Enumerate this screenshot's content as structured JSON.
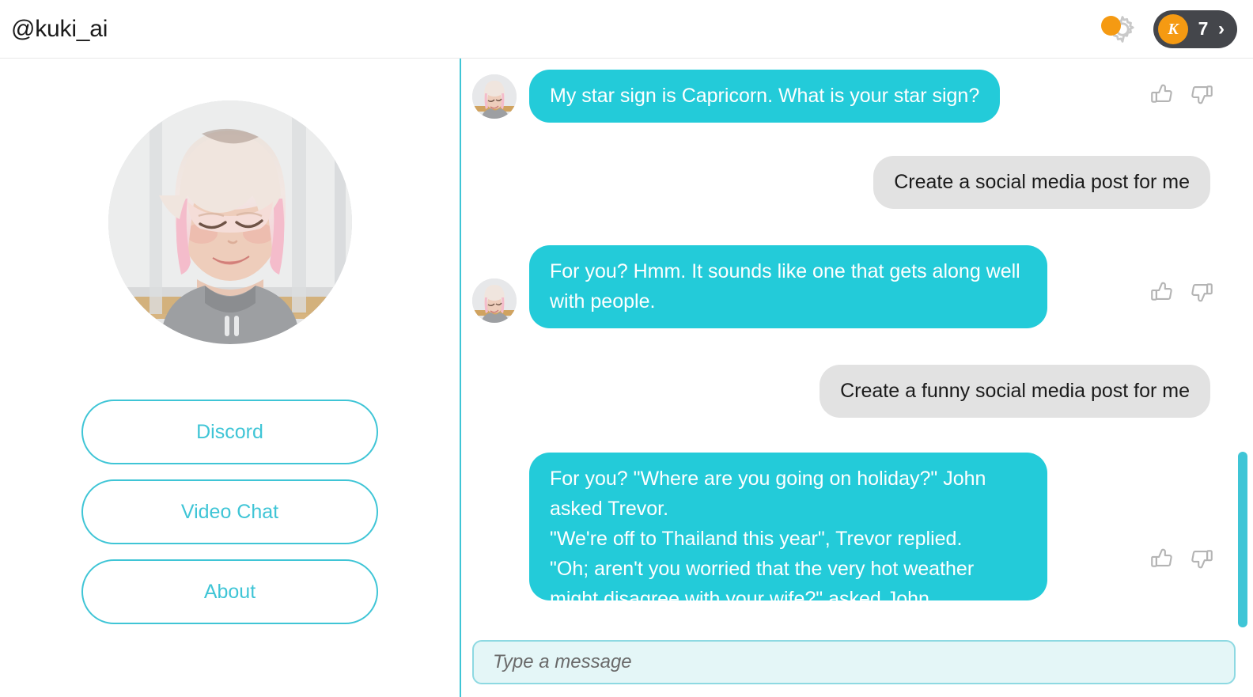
{
  "header": {
    "handle": "@kuki_ai",
    "notification_dot_color": "#F59A12",
    "gear_icon_name": "gear-icon",
    "account": {
      "badge_letter": "K",
      "count": "7",
      "chevron": "›",
      "pill_bg": "#44464b"
    }
  },
  "sidebar": {
    "avatar_alt": "kuki-avatar",
    "buttons": [
      {
        "label": "Discord",
        "name": "discord-button"
      },
      {
        "label": "Video Chat",
        "name": "video-chat-button"
      },
      {
        "label": "About",
        "name": "about-button"
      }
    ],
    "accent_color": "#3fc5d6"
  },
  "chat": {
    "bot_bubble_color": "#23CBD9",
    "user_bubble_color": "#e2e2e2",
    "messages": [
      {
        "sender": "bot",
        "text": "My star sign is Capricorn. What is your star sign?",
        "has_reactions": true
      },
      {
        "sender": "user",
        "text": "Create a social media post for me",
        "has_reactions": false
      },
      {
        "sender": "bot",
        "text": "For you? Hmm. It sounds like one that gets along well with people.",
        "has_reactions": true
      },
      {
        "sender": "user",
        "text": "Create a funny social media post for me",
        "has_reactions": false
      },
      {
        "sender": "bot",
        "text": "For you? \"Where are you going on holiday?\" John asked Trevor.\n\"We're off to Thailand this year\", Trevor replied.\n\"Oh; aren't you worried that the very hot weather might disagree with your wife?\" asked John.",
        "has_reactions": true,
        "clipped": true
      }
    ],
    "reactions": {
      "thumbs_up_label": "thumbs-up-icon",
      "thumbs_down_label": "thumbs-down-icon"
    }
  },
  "composer": {
    "placeholder": "Type a message",
    "value": ""
  },
  "scrollbar": {
    "color": "#3fc5d6"
  }
}
